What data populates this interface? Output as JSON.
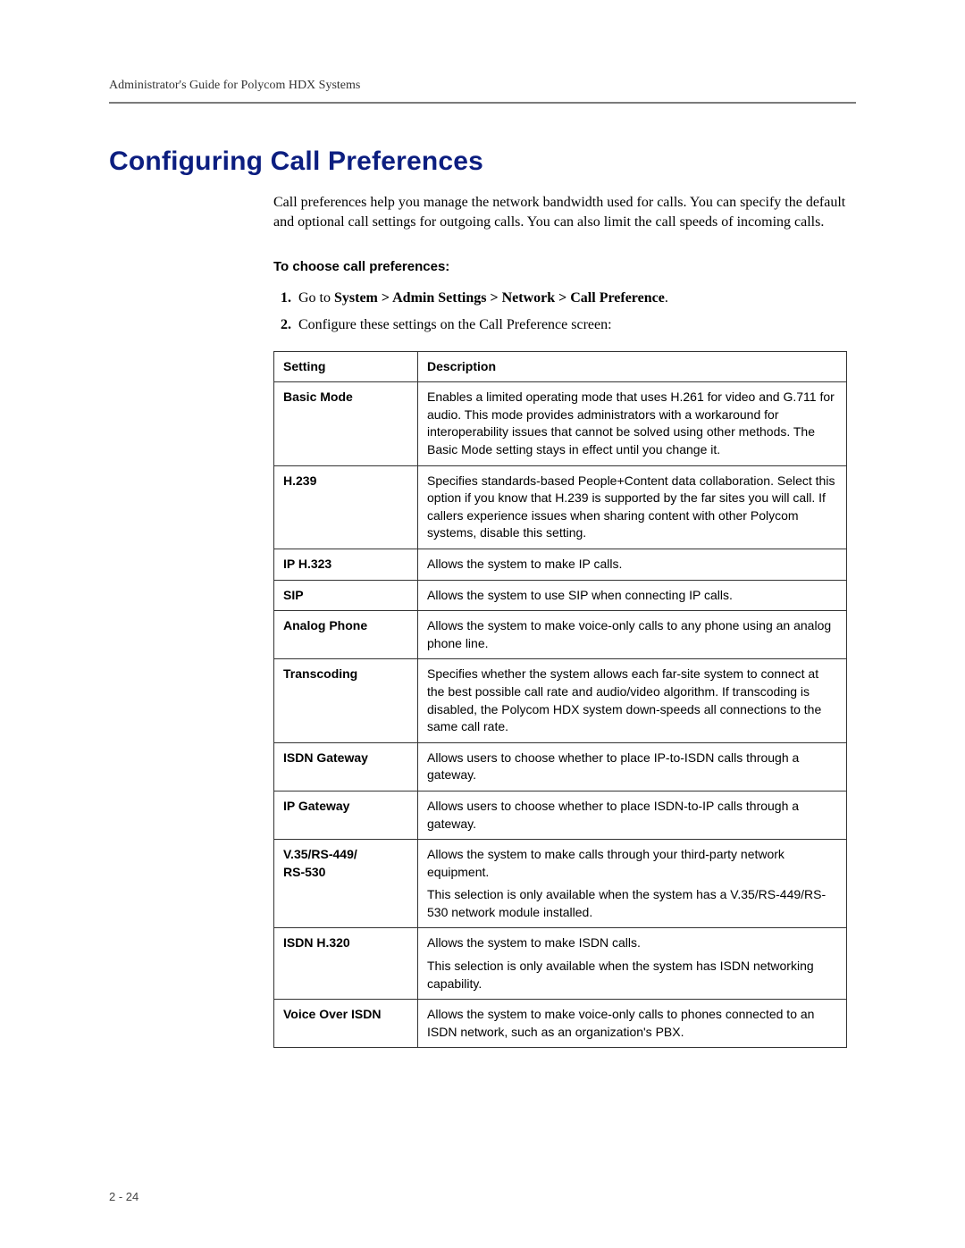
{
  "header": {
    "title": "Administrator's Guide for Polycom HDX Systems"
  },
  "section": {
    "heading": "Configuring Call Preferences",
    "intro": "Call preferences help you manage the network bandwidth used for calls. You can specify the default and optional call settings for outgoing calls. You can also limit the call speeds of incoming calls.",
    "subheading": "To choose call preferences:",
    "step1_prefix": "Go to ",
    "step1_path": "System > Admin Settings > Network > Call Preference",
    "step1_suffix": ".",
    "step2": "Configure these settings on the Call Preference screen:"
  },
  "table": {
    "col1": "Setting",
    "col2": "Description",
    "rows": [
      {
        "setting": "Basic Mode",
        "paras": [
          "Enables a limited operating mode that uses H.261 for video and G.711 for audio. This mode provides administrators with a workaround for interoperability issues that cannot be solved using other methods. The Basic Mode setting stays in effect until you change it."
        ]
      },
      {
        "setting": "H.239",
        "paras": [
          "Specifies standards-based People+Content data collaboration. Select this option if you know that H.239 is supported by the far sites you will call. If callers experience issues when sharing content with other Polycom systems, disable this setting."
        ]
      },
      {
        "setting": "IP H.323",
        "paras": [
          "Allows the system to make IP calls."
        ]
      },
      {
        "setting": "SIP",
        "paras": [
          "Allows the system to use SIP when connecting IP calls."
        ]
      },
      {
        "setting": "Analog Phone",
        "paras": [
          "Allows the system to make voice-only calls to any phone using an analog phone line."
        ]
      },
      {
        "setting": "Transcoding",
        "paras": [
          "Specifies whether the system allows each far-site system to connect at the best possible call rate and audio/video algorithm. If transcoding is disabled, the Polycom HDX system down-speeds all connections to the same call rate."
        ]
      },
      {
        "setting": "ISDN Gateway",
        "paras": [
          "Allows users to choose whether to place IP-to-ISDN calls through a gateway."
        ]
      },
      {
        "setting": "IP Gateway",
        "paras": [
          "Allows users to choose whether to place ISDN-to-IP calls through a gateway."
        ]
      },
      {
        "setting": "V.35/RS-449/\nRS-530",
        "paras": [
          "Allows the system to make calls through your third-party network equipment.",
          "This selection is only available when the system has a V.35/RS-449/RS-530 network module installed."
        ]
      },
      {
        "setting": "ISDN H.320",
        "paras": [
          "Allows the system to make ISDN calls.",
          "This selection is only available when the system has ISDN networking capability."
        ]
      },
      {
        "setting": "Voice Over ISDN",
        "paras": [
          "Allows the system to make voice-only calls to phones connected to an ISDN network, such as an organization's PBX."
        ]
      }
    ]
  },
  "pagenum": "2 - 24"
}
